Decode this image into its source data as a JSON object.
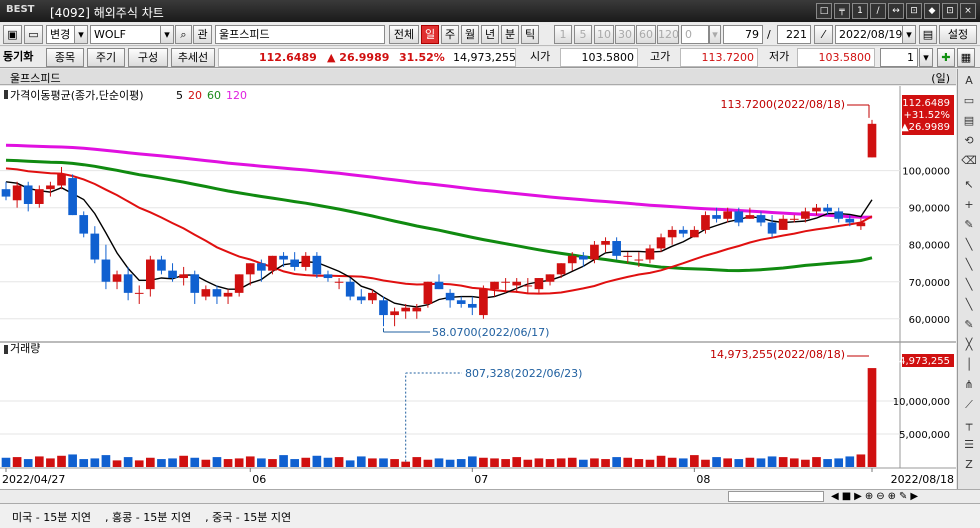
{
  "window": {
    "logo": "BEST",
    "title": "[4092] 해외주식 차트",
    "buttons": [
      "□",
      "╤",
      "1",
      "/",
      "↔",
      "⊡",
      "◆",
      "⊡",
      "×"
    ]
  },
  "toolbar1": {
    "mode": "변경",
    "symbol": "WOLF",
    "search_icon": "search-icon",
    "gwan": "관",
    "name": "울프스피드",
    "range_all": "전체",
    "periods": [
      "일",
      "주",
      "월",
      "년",
      "분",
      "틱"
    ],
    "active_period": "일",
    "intervals": [
      "1",
      "5",
      "10",
      "30",
      "60",
      "120"
    ],
    "zero": "0",
    "count1": "79",
    "slash": "/",
    "count2": "221",
    "date": "2022/08/19",
    "setting": "설정"
  },
  "toolbar2": {
    "sync": "동기화",
    "tabs": [
      "종목",
      "주기",
      "구성",
      "추세선"
    ],
    "price": "112.6489",
    "change": "▲ 26.9989",
    "pct": "31.52%",
    "volume": "14,973,255",
    "open_label": "시가",
    "open": "103.5800",
    "high_label": "고가",
    "high": "113.7200",
    "low_label": "저가",
    "low": "103.5800",
    "n": "1"
  },
  "subtitle": {
    "name": "울프스피드",
    "right": "(일)"
  },
  "price_panel": {
    "title": "가격이동평균(종가,단순이평)",
    "ma_labels": [
      {
        "t": "5",
        "c": "#000000"
      },
      {
        "t": "20",
        "c": "#d01010"
      },
      {
        "t": "60",
        "c": "#1a8a1a"
      },
      {
        "t": "120",
        "c": "#e020e0"
      }
    ],
    "max_ann": "113.7200(2022/08/18)",
    "min_ann": "58.0700(2022/06/17)",
    "last_box": [
      "112.6489",
      "+31.52%",
      "▲26.9989"
    ]
  },
  "volume_panel": {
    "title": "거래량",
    "max_ann": "14,973,255(2022/08/18)",
    "min_ann": "807,328(2022/06/23)",
    "last_box": "14,973,255"
  },
  "status": {
    "text": "미국 - 15분 지연    , 홍콩 - 15분 지연    , 중국 - 15분 지연"
  },
  "colors": {
    "up": "#d01010",
    "down": "#1060d0",
    "ma5": "#000000",
    "ma20": "#e01010",
    "ma60": "#108a10",
    "ma120": "#e010e0"
  },
  "chart_data": {
    "type": "candlestick",
    "price_axis": {
      "ticks": [
        "60,0000",
        "70,0000",
        "80,0000",
        "90,0000",
        "100,0000"
      ],
      "tick_values": [
        60,
        70,
        80,
        90,
        100
      ],
      "ylim": [
        54,
        118
      ]
    },
    "volume_axis": {
      "ticks": [
        "5,000,000",
        "10,000,000"
      ],
      "tick_values": [
        5000000,
        10000000
      ],
      "ylim": [
        0,
        16500000
      ]
    },
    "x_labels": [
      {
        "t": "2022/04/27",
        "i": 0
      },
      {
        "t": "06",
        "i": 22
      },
      {
        "t": "07",
        "i": 42
      },
      {
        "t": "08",
        "i": 62
      },
      {
        "t": "2022/08/18",
        "i": 78
      }
    ],
    "candles": [
      [
        95,
        97,
        92,
        93
      ],
      [
        92,
        97,
        90,
        96
      ],
      [
        96,
        97,
        89,
        91
      ],
      [
        91,
        96,
        90,
        95
      ],
      [
        95,
        97,
        93,
        96
      ],
      [
        96,
        101,
        95,
        99
      ],
      [
        98,
        99,
        88,
        88
      ],
      [
        88,
        89,
        82,
        83
      ],
      [
        83,
        85,
        75,
        76
      ],
      [
        76,
        80,
        68,
        70
      ],
      [
        70,
        73,
        68,
        72
      ],
      [
        72,
        74,
        65,
        67
      ],
      [
        67,
        69,
        64,
        67
      ],
      [
        68,
        77,
        66,
        76
      ],
      [
        76,
        77,
        72,
        73
      ],
      [
        73,
        75,
        70,
        71
      ],
      [
        71,
        74,
        69,
        72
      ],
      [
        72,
        73,
        64,
        67
      ],
      [
        66,
        69,
        65,
        68
      ],
      [
        68,
        69,
        64,
        66
      ],
      [
        66,
        68,
        64,
        67
      ],
      [
        67,
        72,
        66,
        72
      ],
      [
        72,
        75,
        69,
        75
      ],
      [
        75,
        76,
        70,
        73
      ],
      [
        73,
        77,
        72,
        77
      ],
      [
        77,
        78,
        74,
        76
      ],
      [
        76,
        78,
        73,
        74
      ],
      [
        74,
        78,
        73,
        77
      ],
      [
        77,
        78,
        71,
        72
      ],
      [
        72,
        73,
        70,
        71
      ],
      [
        70,
        71,
        68,
        70
      ],
      [
        70,
        71,
        65,
        66
      ],
      [
        66,
        68,
        64,
        65
      ],
      [
        65,
        68,
        64,
        67
      ],
      [
        65,
        66,
        58,
        61
      ],
      [
        61,
        63,
        58,
        62
      ],
      [
        62,
        64,
        60,
        63
      ],
      [
        62,
        64,
        60,
        63
      ],
      [
        64,
        70,
        63,
        70
      ],
      [
        70,
        72,
        68,
        68
      ],
      [
        67,
        68,
        63,
        65
      ],
      [
        65,
        66,
        63,
        64
      ],
      [
        64,
        66,
        61,
        63
      ],
      [
        61,
        69,
        60,
        68
      ],
      [
        68,
        70,
        66,
        70
      ],
      [
        70,
        71,
        67,
        70
      ],
      [
        69,
        71,
        67,
        70
      ],
      [
        69,
        71,
        67,
        69
      ],
      [
        68,
        71,
        67,
        71
      ],
      [
        70,
        72,
        69,
        72
      ],
      [
        72,
        75,
        71,
        75
      ],
      [
        75,
        78,
        73,
        77
      ],
      [
        77,
        78,
        74,
        76
      ],
      [
        76,
        81,
        75,
        80
      ],
      [
        80,
        82,
        78,
        81
      ],
      [
        81,
        82,
        76,
        77
      ],
      [
        77,
        78,
        75,
        77
      ],
      [
        76,
        78,
        74,
        76
      ],
      [
        76,
        80,
        75,
        79
      ],
      [
        79,
        83,
        78,
        82
      ],
      [
        82,
        85,
        80,
        84
      ],
      [
        84,
        85,
        82,
        83
      ],
      [
        82,
        85,
        82,
        84
      ],
      [
        84,
        89,
        83,
        88
      ],
      [
        88,
        90,
        86,
        87
      ],
      [
        87,
        90,
        86,
        89
      ],
      [
        89,
        90,
        85,
        86
      ],
      [
        87,
        90,
        87,
        88
      ],
      [
        88,
        89,
        85,
        86
      ],
      [
        86,
        88,
        82,
        83
      ],
      [
        84,
        88,
        84,
        87
      ],
      [
        87,
        88,
        86,
        87
      ],
      [
        87,
        90,
        86,
        89
      ],
      [
        89,
        91,
        88,
        90
      ],
      [
        90,
        91,
        88,
        89
      ],
      [
        89,
        90,
        86,
        87
      ],
      [
        87,
        88,
        85,
        86
      ],
      [
        85,
        87,
        84,
        86
      ],
      [
        103.58,
        113.72,
        103.58,
        112.65
      ]
    ],
    "volume": [
      1400000,
      1500000,
      1200000,
      1600000,
      1300000,
      1700000,
      1900000,
      1200000,
      1300000,
      1800000,
      1000000,
      1500000,
      1000000,
      1400000,
      1200000,
      1300000,
      1700000,
      1400000,
      1100000,
      1500000,
      1200000,
      1300000,
      1600000,
      1300000,
      1200000,
      1800000,
      1200000,
      1400000,
      1700000,
      1400000,
      1500000,
      1000000,
      1600000,
      1300000,
      1300000,
      1200000,
      807328,
      1500000,
      1100000,
      1300000,
      1100000,
      1200000,
      1600000,
      1400000,
      1300000,
      1200000,
      1500000,
      1100000,
      1300000,
      1200000,
      1300000,
      1400000,
      1100000,
      1300000,
      1200000,
      1500000,
      1400000,
      1200000,
      1100000,
      1700000,
      1400000,
      1300000,
      1800000,
      1100000,
      1500000,
      1300000,
      1200000,
      1400000,
      1300000,
      1600000,
      1500000,
      1300000,
      1100000,
      1500000,
      1200000,
      1300000,
      1600000,
      1900000,
      14973255
    ]
  }
}
